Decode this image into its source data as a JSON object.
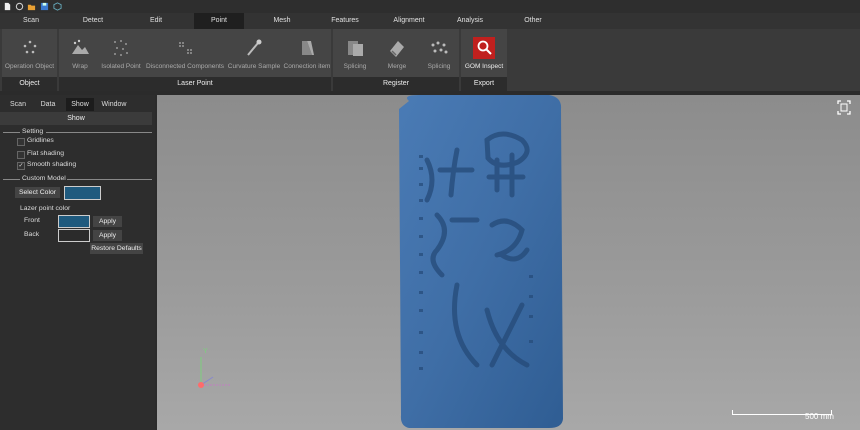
{
  "menu_tabs": [
    "Scan",
    "Detect",
    "Edit",
    "Point",
    "Mesh",
    "Features",
    "Alignment",
    "Analysis",
    "Other"
  ],
  "active_tab": "Point",
  "ribbon": {
    "groups": [
      {
        "label": "Object",
        "buttons": [
          "Operation Object"
        ]
      },
      {
        "label": "Laser Point",
        "buttons": [
          "Wrap",
          "Isolated Point",
          "Disconnected Components",
          "Curvature Sample",
          "Connection item"
        ]
      },
      {
        "label": "Register",
        "buttons": [
          "Splicing",
          "Merge",
          "Splicing"
        ]
      },
      {
        "label": "Export",
        "buttons": [
          "GOM Inspect"
        ]
      }
    ]
  },
  "panel": {
    "tabs": [
      "Scan",
      "Data",
      "Show",
      "Window"
    ],
    "active_tab": "Show",
    "header": "Show",
    "setting": {
      "title": "Setting",
      "options": [
        {
          "label": "Gridlines",
          "checked": false
        },
        {
          "label": "Flat shading",
          "checked": false
        },
        {
          "label": "Smooth shading",
          "checked": true
        }
      ]
    },
    "custom_model": {
      "title": "Custom Model",
      "select_color_label": "Select Color",
      "model_color": "#1f5a7e",
      "lazer_title": "Lazer point color",
      "front_label": "Front",
      "front_color": "#1f5a7e",
      "back_label": "Back",
      "back_color": "#2b2b2b",
      "apply_label": "Apply",
      "restore_label": "Restore Defaults"
    }
  },
  "viewport": {
    "model_color": "#3f6ea6",
    "axis_y": "Y",
    "scale_label": "500 mm"
  }
}
